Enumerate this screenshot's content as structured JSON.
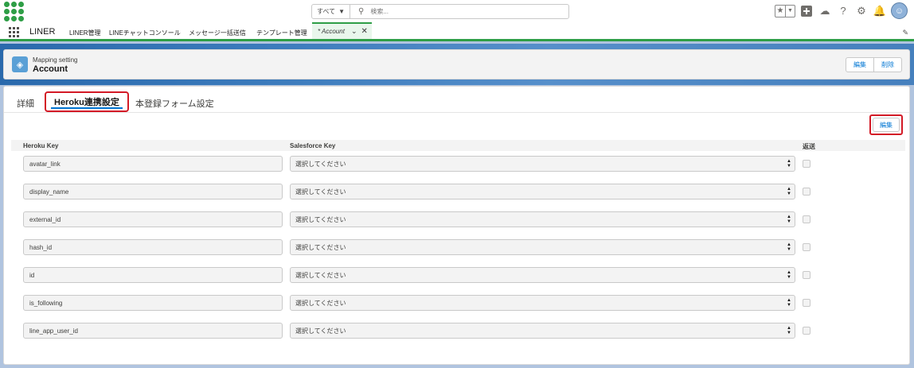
{
  "search": {
    "scope": "すべて",
    "placeholder": "検索..."
  },
  "nav": {
    "app_name": "LINER",
    "items": [
      "LINER管理",
      "LINEチャットコンソール",
      "メッセージ一括送信",
      "テンプレート管理"
    ],
    "active_tab": "* Account"
  },
  "record": {
    "type": "Mapping setting",
    "title": "Account",
    "edit_label": "編集",
    "delete_label": "削除"
  },
  "tabs": [
    "詳細",
    "Heroku連携設定",
    "本登録フォーム設定"
  ],
  "active_tab_index": 1,
  "section": {
    "edit_label": "編集"
  },
  "table": {
    "headers": {
      "heroku_key": "Heroku Key",
      "salesforce_key": "Salesforce Key",
      "resend": "返送"
    },
    "select_placeholder": "選択してください",
    "rows": [
      {
        "heroku_key": "avatar_link"
      },
      {
        "heroku_key": "display_name"
      },
      {
        "heroku_key": "external_id"
      },
      {
        "heroku_key": "hash_id"
      },
      {
        "heroku_key": "id"
      },
      {
        "heroku_key": "is_following"
      },
      {
        "heroku_key": "line_app_user_id"
      }
    ]
  },
  "colors": {
    "brand_green": "#2e9e46",
    "link_blue": "#0176d3",
    "highlight_red": "#d31a26"
  }
}
